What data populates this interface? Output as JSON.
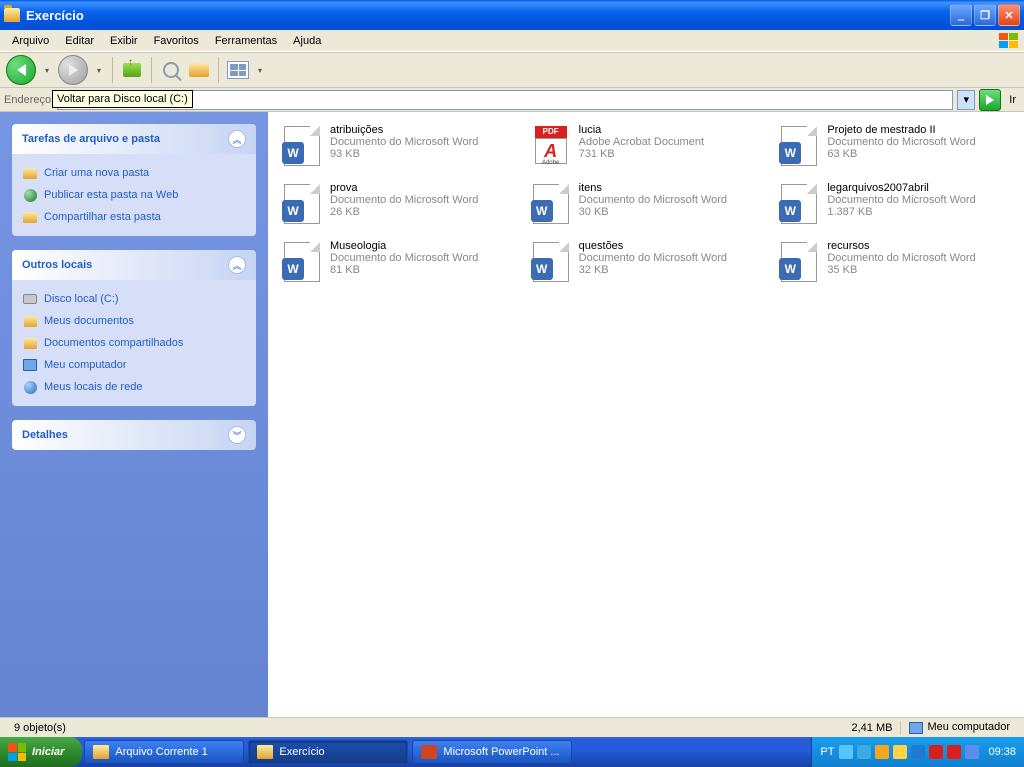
{
  "window": {
    "title": "Exercício"
  },
  "menu": [
    "Arquivo",
    "Editar",
    "Exibir",
    "Favoritos",
    "Ferramentas",
    "Ajuda"
  ],
  "address": {
    "label": "Endereço",
    "tooltip": "Voltar para Disco local (C:)",
    "go": "Ir"
  },
  "tasks": {
    "t1": {
      "title": "Tarefas de arquivo e pasta",
      "a": "Criar uma nova pasta",
      "b": "Publicar esta pasta na Web",
      "c": "Compartilhar esta pasta"
    },
    "t2": {
      "title": "Outros locais",
      "a": "Disco local (C:)",
      "b": "Meus documentos",
      "c": "Documentos compartilhados",
      "d": "Meu computador",
      "e": "Meus locais de rede"
    },
    "t3": {
      "title": "Detalhes"
    }
  },
  "types": {
    "word": "Documento do Microsoft Word",
    "pdf": "Adobe Acrobat Document"
  },
  "files": {
    "f0": {
      "name": "atribuições",
      "type": "word",
      "size": "93 KB"
    },
    "f1": {
      "name": "lucia",
      "type": "pdf",
      "size": "731 KB"
    },
    "f2": {
      "name": "Projeto de mestrado II",
      "type": "word",
      "size": "63 KB"
    },
    "f3": {
      "name": "prova",
      "type": "word",
      "size": "26 KB"
    },
    "f4": {
      "name": "itens",
      "type": "word",
      "size": "30 KB"
    },
    "f5": {
      "name": "legarquivos2007abril",
      "type": "word",
      "size": "1.387 KB"
    },
    "f6": {
      "name": "Museologia",
      "type": "word",
      "size": "81 KB"
    },
    "f7": {
      "name": "questões",
      "type": "word",
      "size": "32 KB"
    },
    "f8": {
      "name": "recursos",
      "type": "word",
      "size": "35 KB"
    }
  },
  "status": {
    "objects": "9 objeto(s)",
    "size": "2,41 MB",
    "location": "Meu computador"
  },
  "taskbar": {
    "start": "Iniciar",
    "t0": "Arquivo Corrente 1",
    "t1": "Exercício",
    "t2": "Microsoft PowerPoint ...",
    "lang": "PT",
    "clock": "09:38"
  },
  "tray_colors": [
    "#59c5ff",
    "#3da9e0",
    "#f5a623",
    "#ffd24a",
    "#1e7ad6",
    "#d8201f",
    "#d8201f",
    "#5b8def"
  ]
}
